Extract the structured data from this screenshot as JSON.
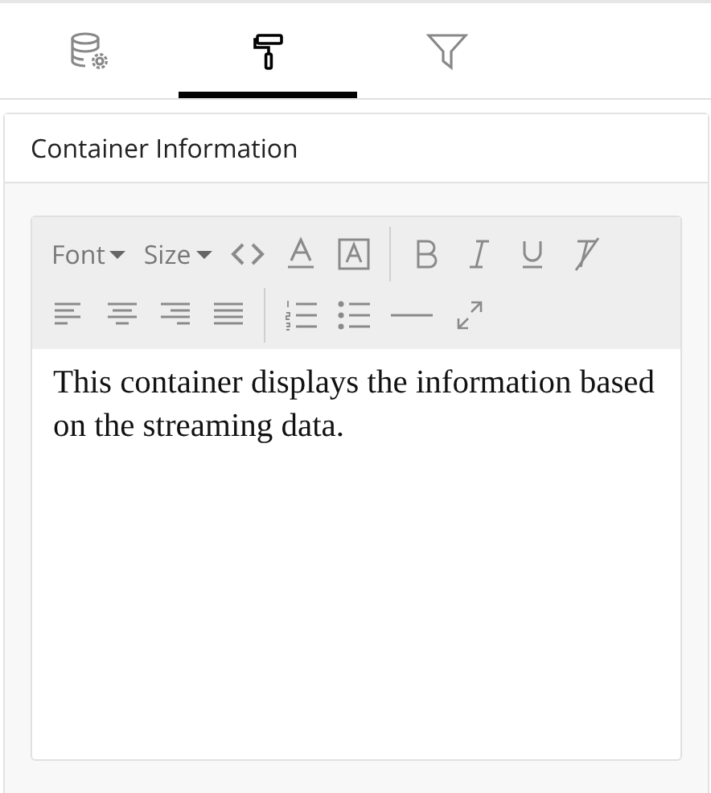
{
  "tabs": [
    {
      "selected": false
    },
    {
      "selected": true
    },
    {
      "selected": false
    }
  ],
  "panel": {
    "title": "Container Information"
  },
  "editor": {
    "dropdowns": [
      {
        "label": "Font"
      },
      {
        "label": "Size"
      }
    ],
    "content": "This container displays the information based on the streaming data."
  }
}
